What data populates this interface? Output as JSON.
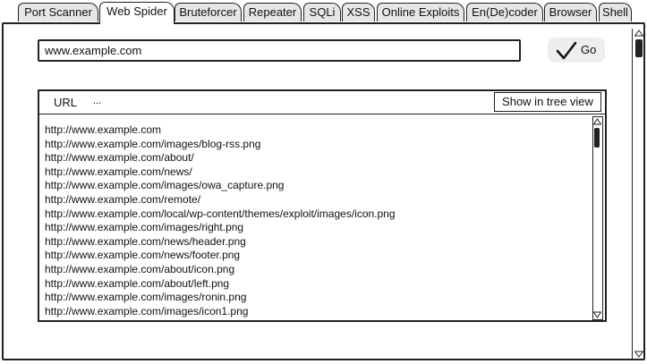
{
  "tabs": [
    {
      "label": "Port Scanner",
      "active": false
    },
    {
      "label": "Web Spider",
      "active": true
    },
    {
      "label": "Bruteforcer",
      "active": false
    },
    {
      "label": "Repeater",
      "active": false
    },
    {
      "label": "SQLi",
      "active": false
    },
    {
      "label": "XSS",
      "active": false
    },
    {
      "label": "Online Exploits",
      "active": false
    },
    {
      "label": "En(De)coder",
      "active": false
    },
    {
      "label": "Browser",
      "active": false
    },
    {
      "label": "Shell",
      "active": false
    }
  ],
  "url_input": {
    "value": "www.example.com"
  },
  "go_button": {
    "label": "Go",
    "icon": "checkmark-icon"
  },
  "results": {
    "column_url": "URL",
    "column_more": "...",
    "tree_view_button": "Show in tree view",
    "urls": [
      "http://www.example.com",
      "http://www.example.com/images/blog-rss.png",
      "http://www.example.com/about/",
      "http://www.example.com/news/",
      "http://www.example.com/images/owa_capture.png",
      "http://www.example.com/remote/",
      "http://www.example.com/local/wp-content/themes/exploit/images/icon.png",
      "http://www.example.com/images/right.png",
      "http://www.example.com/news/header.png",
      "http://www.example.com/news/footer.png",
      "http://www.example.com/about/icon.png",
      "http://www.example.com/about/left.png",
      "http://www.example.com/images/ronin.png",
      "http://www.example.com/images/icon1.png"
    ]
  }
}
